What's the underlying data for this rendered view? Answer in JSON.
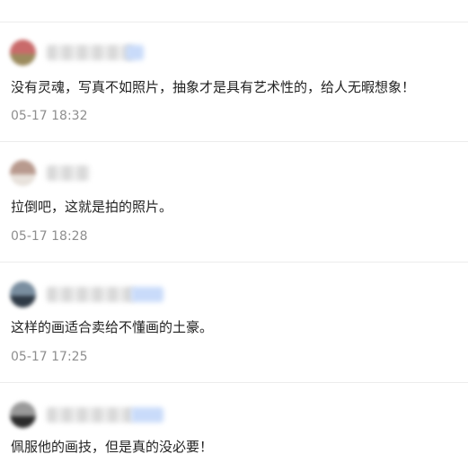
{
  "comments": [
    {
      "text": "没有灵魂，写真不如照片，抽象才是具有艺术性的，给人无暇想象！",
      "time": "05-17 18:32",
      "avatar_colors": [
        "#c96a6a",
        "#9c8b5e"
      ]
    },
    {
      "text": "拉倒吧，这就是拍的照片。",
      "time": "05-17 18:28",
      "avatar_colors": [
        "#b89a8e",
        "#e8e2dc"
      ]
    },
    {
      "text": "这样的画适合卖给不懂画的土豪。",
      "time": "05-17 17:25",
      "avatar_colors": [
        "#7a8ea0",
        "#2f3a46"
      ]
    },
    {
      "text": "佩服他的画技，但是真的没必要！",
      "time": "",
      "avatar_colors": [
        "#9a9a9a",
        "#2b2b2b"
      ]
    }
  ],
  "colors": {
    "divider": "#ececec",
    "text": "#222222",
    "timestamp": "#8e8e8e",
    "badge_blur": "#c9dbfa"
  }
}
